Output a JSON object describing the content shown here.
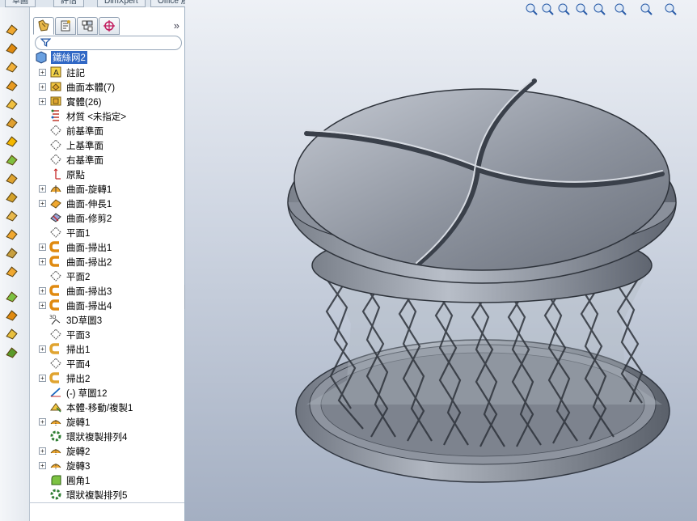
{
  "top_tabs": [
    "草圖",
    "評估",
    "DimXpert",
    "Office 產品"
  ],
  "panel": {
    "tabs": [
      "feature-manager-tab",
      "property-manager-tab",
      "configuration-manager-tab",
      "dim-xpert-manager-tab"
    ],
    "expand": "»"
  },
  "tree": {
    "root": "鐵絲网2",
    "items": [
      {
        "label": "註記",
        "icon": "annotation-icon",
        "expandable": true
      },
      {
        "label": "曲面本體(7)",
        "icon": "surface-bodies-folder-icon",
        "expandable": true
      },
      {
        "label": "實體(26)",
        "icon": "solid-bodies-folder-icon",
        "expandable": true
      },
      {
        "label": "材質 <未指定>",
        "icon": "material-icon",
        "expandable": false
      },
      {
        "label": "前基準面",
        "icon": "plane-icon",
        "expandable": false
      },
      {
        "label": "上基準面",
        "icon": "plane-icon",
        "expandable": false
      },
      {
        "label": "右基準面",
        "icon": "plane-icon",
        "expandable": false
      },
      {
        "label": "原點",
        "icon": "origin-icon",
        "expandable": false
      },
      {
        "label": "曲面-旋轉1",
        "icon": "surface-revolve-icon",
        "expandable": true
      },
      {
        "label": "曲面-伸長1",
        "icon": "surface-extrude-icon",
        "expandable": true
      },
      {
        "label": "曲面-修剪2",
        "icon": "surface-trim-icon",
        "expandable": false
      },
      {
        "label": "平面1",
        "icon": "plane-icon",
        "expandable": false
      },
      {
        "label": "曲面-掃出1",
        "icon": "surface-sweep-icon",
        "expandable": true
      },
      {
        "label": "曲面-掃出2",
        "icon": "surface-sweep-icon",
        "expandable": true
      },
      {
        "label": "平面2",
        "icon": "plane-icon",
        "expandable": false
      },
      {
        "label": "曲面-掃出3",
        "icon": "surface-sweep-icon",
        "expandable": true
      },
      {
        "label": "曲面-掃出4",
        "icon": "surface-sweep-icon",
        "expandable": true
      },
      {
        "label": "3D草圖3",
        "icon": "3d-sketch-icon",
        "expandable": false
      },
      {
        "label": "平面3",
        "icon": "plane-icon",
        "expandable": false
      },
      {
        "label": "掃出1",
        "icon": "sweep-icon",
        "expandable": true
      },
      {
        "label": "平面4",
        "icon": "plane-icon",
        "expandable": false
      },
      {
        "label": "掃出2",
        "icon": "sweep-icon",
        "expandable": true
      },
      {
        "label": "(-) 草圖12",
        "icon": "sketch-icon",
        "expandable": false
      },
      {
        "label": "本體-移動/複製1",
        "icon": "move-copy-body-icon",
        "expandable": false
      },
      {
        "label": "旋轉1",
        "icon": "revolve-icon",
        "expandable": true
      },
      {
        "label": "環狀複製排列4",
        "icon": "circular-pattern-icon",
        "expandable": false
      },
      {
        "label": "旋轉2",
        "icon": "revolve-icon",
        "expandable": true
      },
      {
        "label": "旋轉3",
        "icon": "revolve-icon",
        "expandable": true
      },
      {
        "label": "圓角1",
        "icon": "fillet-icon",
        "expandable": false
      },
      {
        "label": "環狀複製排列5",
        "icon": "circular-pattern-icon",
        "expandable": false
      }
    ]
  },
  "left_toolbar": [
    "extruded-surface-icon",
    "revolved-surface-icon",
    "swept-surface-icon",
    "lofted-surface-icon",
    "boundary-surface-icon",
    "filled-surface-icon",
    "planar-surface-icon",
    "offset-surface-icon",
    "ruled-surface-icon",
    "radiate-surface-icon",
    "extend-surface-icon",
    "trim-surface-icon",
    "untrim-surface-icon",
    "knit-surface-icon",
    "fillet-icon",
    "delete-face-icon",
    "reference-geometry-icon",
    "curves-icon"
  ],
  "view_tools": [
    "zoom-to-fit-icon",
    "zoom-to-area-icon",
    "previous-view-icon",
    "section-view-icon",
    "view-orientation-icon",
    "display-style-icon",
    "hide-show-items-icon",
    "appearance-icon"
  ],
  "colors": {
    "selection": "#3168c5",
    "viewport_top": "#eef1f6",
    "viewport_bottom": "#a4afc2",
    "model": "#8a909c"
  }
}
